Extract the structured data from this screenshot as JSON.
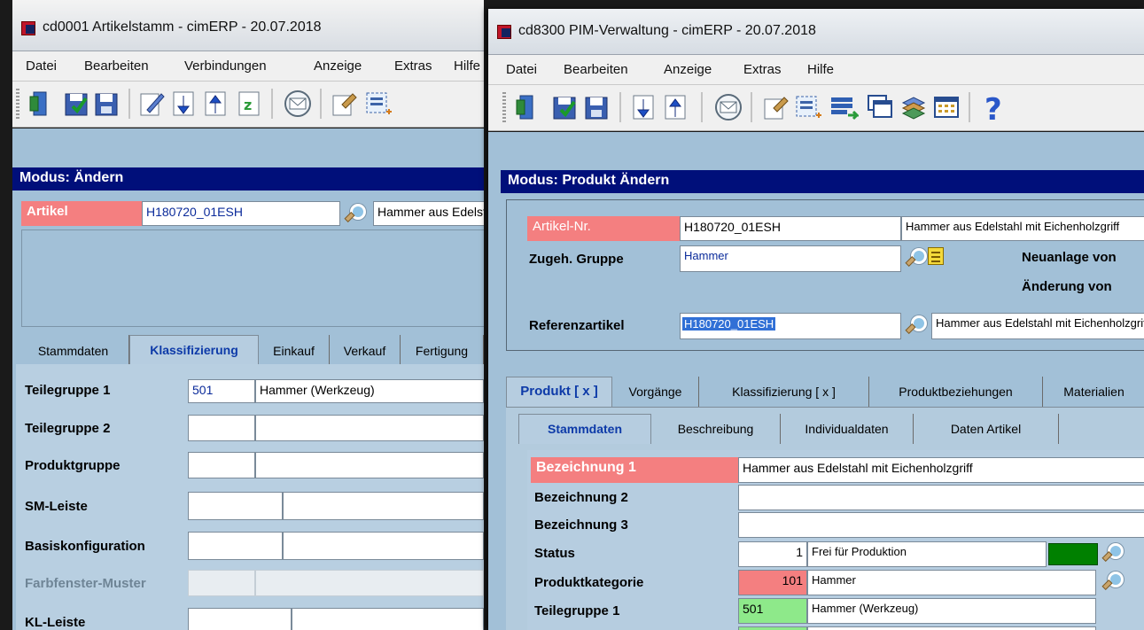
{
  "left_window": {
    "title": "cd0001 Artikelstamm - cimERP - 20.07.2018",
    "menu": [
      "Datei",
      "Bearbeiten",
      "Verbindungen",
      "Anzeige",
      "Extras",
      "Hilfe"
    ],
    "modus": "Modus: Ändern",
    "artikel_label": "Artikel",
    "artikel_value": "H180720_01ESH",
    "artikel_desc": "Hammer aus Edelstahl mit Eichenholzgriff",
    "tabs": [
      "Stammdaten",
      "Klassifizierung",
      "Einkauf",
      "Verkauf",
      "Fertigung"
    ],
    "active_tab": "Klassifizierung",
    "rows": [
      {
        "label": "Teilegruppe 1",
        "code": "501",
        "desc": "Hammer (Werkzeug)"
      },
      {
        "label": "Teilegruppe 2",
        "code": "",
        "desc": ""
      },
      {
        "label": "Produktgruppe",
        "code": "",
        "desc": ""
      },
      {
        "label": "SM-Leiste",
        "code": "",
        "desc": ""
      },
      {
        "label": "Basiskonfiguration",
        "code": "",
        "desc": ""
      },
      {
        "label": "Farbfenster-Muster",
        "code": "",
        "desc": ""
      },
      {
        "label": "KL-Leiste",
        "code": "",
        "desc": ""
      }
    ]
  },
  "right_window": {
    "title": "cd8300 PIM-Verwaltung - cimERP - 20.07.2018",
    "menu": [
      "Datei",
      "Bearbeiten",
      "Anzeige",
      "Extras",
      "Hilfe"
    ],
    "modus": "Modus: Produkt Ändern",
    "artikel_nr_label": "Artikel-Nr.",
    "artikel_nr_value": "H180720_01ESH",
    "artikel_desc": "Hammer aus Edelstahl mit Eichenholzgriff",
    "gruppe_label": "Zugeh. Gruppe",
    "gruppe_value": "Hammer",
    "neuanlage_label": "Neuanlage von",
    "aenderung_label": "Änderung von",
    "referenz_label": "Referenzartikel",
    "referenz_value": "H180720_01ESH",
    "referenz_desc": "Hammer aus Edelstahl mit Eichenholzgriff",
    "tabs": [
      "Produkt [ x ]",
      "Vorgänge",
      "Klassifizierung [ x ]",
      "Produktbeziehungen",
      "Materialien"
    ],
    "subtabs": [
      "Stammdaten",
      "Beschreibung",
      "Individualdaten",
      "Daten Artikel"
    ],
    "bezeichnung1_label": "Bezeichnung 1",
    "bezeichnung1_value": "Hammer aus Edelstahl mit Eichenholzgriff",
    "bezeichnung2_label": "Bezeichnung 2",
    "bezeichnung3_label": "Bezeichnung 3",
    "status_label": "Status",
    "status_code": "1",
    "status_desc": "Frei für Produktion",
    "status_color": "#008000",
    "produktkategorie_label": "Produktkategorie",
    "produktkategorie_code": "101",
    "produktkategorie_desc": "Hammer",
    "teilegruppe1_label": "Teilegruppe 1",
    "teilegruppe1_code": "501",
    "teilegruppe1_desc": "Hammer (Werkzeug)"
  }
}
